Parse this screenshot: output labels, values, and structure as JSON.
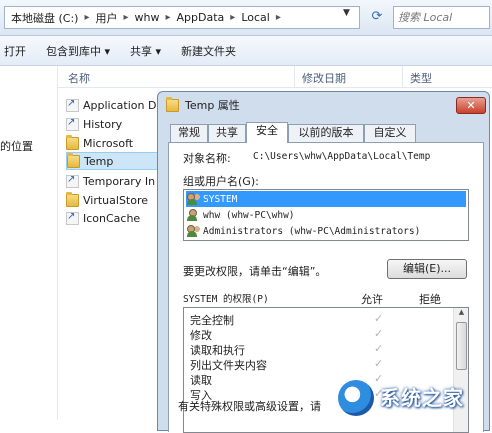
{
  "address": {
    "crumbs": [
      "本地磁盘 (C:)",
      "用户",
      "whw",
      "AppData",
      "Local"
    ],
    "separator": "▸"
  },
  "search": {
    "placeholder": "搜索 Local"
  },
  "toolbar": [
    "打开",
    "包含到库中 ▾",
    "共享 ▾",
    "新建文件夹"
  ],
  "columns": {
    "name": "名称",
    "modified": "修改日期",
    "type": "类型"
  },
  "left_pane": {
    "partial_label": "的位置"
  },
  "files": [
    {
      "name": "Application D",
      "icon": "shortcut-icon"
    },
    {
      "name": "History",
      "icon": "shortcut-icon"
    },
    {
      "name": "Microsoft",
      "icon": "folder-icon"
    },
    {
      "name": "Temp",
      "icon": "folder-icon",
      "selected": true
    },
    {
      "name": "Temporary In",
      "icon": "shortcut-icon"
    },
    {
      "name": "VirtualStore",
      "icon": "folder-icon"
    },
    {
      "name": "IconCache",
      "icon": "file-icon"
    }
  ],
  "dialog": {
    "title": "Temp 属性",
    "close": "✕",
    "tabs": [
      "常规",
      "共享",
      "安全",
      "以前的版本",
      "自定义"
    ],
    "active_tab": "安全",
    "object_label": "对象名称:",
    "object_value": "C:\\Users\\whw\\AppData\\Local\\Temp",
    "group_label": "组或用户名(G):",
    "users": [
      {
        "name": "SYSTEM",
        "selected": true
      },
      {
        "name": "whw (whw-PC\\whw)",
        "selected": false
      },
      {
        "name": "Administrators (whw-PC\\Administrators)",
        "selected": false
      }
    ],
    "change_hint": "要更改权限，请单击“编辑”。",
    "edit_button": "编辑(E)...",
    "perm_header": "SYSTEM 的权限(P)",
    "allow_label": "允许",
    "deny_label": "拒绝",
    "permissions": [
      {
        "name": "完全控制",
        "allow": true
      },
      {
        "name": "修改",
        "allow": true
      },
      {
        "name": "读取和执行",
        "allow": true
      },
      {
        "name": "列出文件夹内容",
        "allow": true
      },
      {
        "name": "读取",
        "allow": true
      },
      {
        "name": "写入",
        "allow": true
      }
    ],
    "footer_text": "有关特殊权限或高级设置，请"
  },
  "watermark": {
    "text": "系统之家"
  }
}
